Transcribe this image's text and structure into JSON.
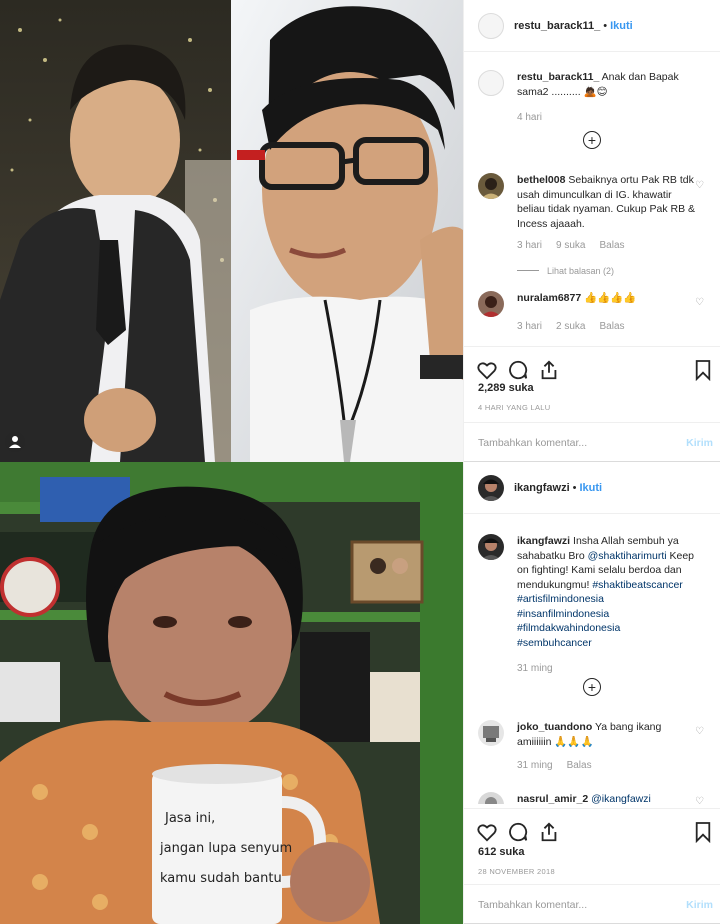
{
  "post1": {
    "username": "restu_barack11_",
    "follow_label": "Ikuti",
    "caption_user": "restu_barack11_",
    "caption_text": "Anak dan Bapak sama2 .......... 🙇🏾😊",
    "caption_time": "4 hari",
    "comments": [
      {
        "user": "bethel008",
        "text": "Sebaiknya ortu Pak RB tdk usah dimunculkan di IG. khawatir beliau tidak nyaman. Cukup Pak RB & Incess ajaaah.",
        "time": "3 hari",
        "likes": "9 suka",
        "reply": "Balas",
        "view_replies": "Lihat balasan (2)"
      },
      {
        "user": "nuralam6877",
        "text": "👍👍👍👍",
        "time": "3 hari",
        "likes": "2 suka",
        "reply": "Balas"
      }
    ],
    "likes": "2,289 suka",
    "date": "4 HARI YANG LALU",
    "add_comment_placeholder": "Tambahkan komentar...",
    "send_label": "Kirim"
  },
  "post2": {
    "username": "ikangfawzi",
    "follow_label": "Ikuti",
    "caption_user": "ikangfawzi",
    "caption_text": "Insha Allah sembuh ya sahabatku Bro",
    "caption_mention": "@shaktiharimurti",
    "caption_text2": "Keep on fighting! Kami selalu berdoa dan mendukungmu!",
    "hashtags": [
      "#shaktibeatscancer",
      "#artisfilmindonesia",
      "#insanfilmindonesia",
      "#filmdakwahindonesia",
      "#sembuhcancer"
    ],
    "caption_time": "31 ming",
    "comments": [
      {
        "user": "joko_tuandono",
        "text": "Ya bang ikang amiiiiiin 🙏🙏🙏",
        "time": "31 ming",
        "reply": "Balas"
      },
      {
        "user": "nasrul_amir_2",
        "text": "@ikangfawzi"
      }
    ],
    "likes": "612 suka",
    "date": "28 NOVEMBER 2018",
    "add_comment_placeholder": "Tambahkan komentar...",
    "send_label": "Kirim"
  },
  "photo2_mug_text": "Jasa ini, jangan lupa senyum kamu sudah bantu",
  "icons": [
    "heart-icon",
    "comment-icon",
    "share-icon",
    "bookmark-icon",
    "plus-circle-icon",
    "user-tag-icon"
  ],
  "colors": {
    "link": "#3897f0",
    "send_disabled": "#b2dffc",
    "hashtag": "#003569",
    "muted": "#999999"
  }
}
